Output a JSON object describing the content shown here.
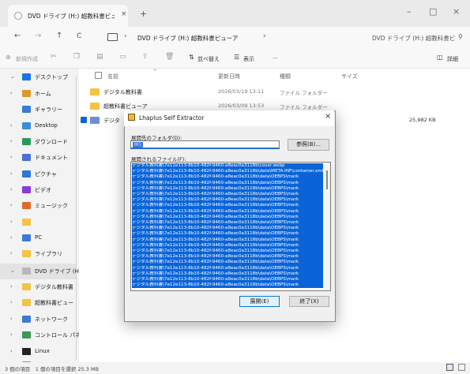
{
  "window": {
    "tab_title": "DVD ドライブ (H:) 超教科書ビューア",
    "tab_close": "×",
    "new_tab": "+",
    "controls": {
      "minimize": "–",
      "maximize": "□",
      "close": "×"
    }
  },
  "nav": {
    "back": "←",
    "forward": "→",
    "up": "↑",
    "refresh": "C",
    "address": "DVD ドライブ (H:) 超教科書ビューア",
    "address_sep": "›",
    "search_placeholder": "DVD ドライブ (H:) 超教科書ビ",
    "search_glyph": "⚲"
  },
  "command_bar": {
    "new": "新規作成",
    "sort": "並べ替え",
    "view": "表示",
    "more": "···",
    "details": "詳細"
  },
  "sidebar": {
    "items": [
      {
        "label": "デスクトップ",
        "chev": "⌄",
        "color": "#1a73e8"
      },
      {
        "label": "ホーム",
        "chev": "›",
        "color": "#d89a2a"
      },
      {
        "label": "ギャラリー",
        "chev": "",
        "color": "#3a7bd5"
      },
      {
        "label": "Desktop",
        "chev": "›",
        "color": "#3a8fd8"
      },
      {
        "label": "ダウンロード",
        "chev": "›",
        "color": "#2a9a5a"
      },
      {
        "label": "ドキュメント",
        "chev": "›",
        "color": "#4a6fd8"
      },
      {
        "label": "ピクチャ",
        "chev": "›",
        "color": "#2a7ad8"
      },
      {
        "label": "ビデオ",
        "chev": "›",
        "color": "#8a3ad8"
      },
      {
        "label": "ミュージック",
        "chev": "›",
        "color": "#e06a2a"
      },
      {
        "label": "",
        "chev": "›",
        "color": "#f3c343"
      },
      {
        "label": "PC",
        "chev": "›",
        "color": "#3a7bd5"
      },
      {
        "label": "ライブラリ",
        "chev": "›",
        "color": "#f3c343"
      },
      {
        "label": "DVD ドライブ (H",
        "chev": "⌄",
        "color": "#b8b8b8"
      },
      {
        "label": "デジタル教科書",
        "chev": "›",
        "color": "#f3c343"
      },
      {
        "label": "超教科書ビュー",
        "chev": "›",
        "color": "#f3c343"
      },
      {
        "label": "ネットワーク",
        "chev": "›",
        "color": "#3a7bd5"
      },
      {
        "label": "コントロール パネ",
        "chev": "›",
        "color": "#3a9a5a"
      },
      {
        "label": "Linux",
        "chev": "›",
        "color": "#222222"
      },
      {
        "label": "ごみ箱",
        "chev": "",
        "color": "#7a9ab8"
      }
    ]
  },
  "file_list": {
    "headers": {
      "name": "名前",
      "date": "更新日時",
      "type": "種類",
      "size": "サイズ"
    },
    "rows": [
      {
        "name": "デジタル教科書",
        "date": "2026/03/19 13:11",
        "type": "ファイル フォルダー",
        "size": ""
      },
      {
        "name": "超教科書ビューア",
        "date": "2026/03/09 13:53",
        "type": "ファイル フォルダー",
        "size": ""
      },
      {
        "name": "デジタ",
        "date": "",
        "type": "",
        "size": "25,982 KB"
      }
    ]
  },
  "status": {
    "text": "3 個の項目　1 個の項目を選択 25.3 MB"
  },
  "dialog": {
    "title": "Lhaplus Self Extractor",
    "close": "×",
    "dest_label": "展開先のフォルダ(D):",
    "dest_value": "H:\\",
    "browse_label": "参照(B)...",
    "files_label": "展開されるファイル(F):",
    "files": [
      "デジタル教科書\\7e12e113-8b10-482f-9460-a8eac0a3118b\\cover.webp",
      "デジタル教科書\\7e12e113-8b10-482f-9460-a8eac0a3118b\\data\\META-INF\\container.xml",
      "デジタル教科書\\7e12e113-8b10-482f-9460-a8eac0a3118b\\data\\OEBPS\\mark",
      "デジタル教科書\\7e12e113-8b10-482f-9460-a8eac0a3118b\\data\\OEBPS\\mark",
      "デジタル教科書\\7e12e113-8b10-482f-9460-a8eac0a3118b\\data\\OEBPS\\mark",
      "デジタル教科書\\7e12e113-8b10-482f-9460-a8eac0a3118b\\data\\OEBPS\\mark",
      "デジタル教科書\\7e12e113-8b10-482f-9460-a8eac0a3118b\\data\\OEBPS\\mark",
      "デジタル教科書\\7e12e113-8b10-482f-9460-a8eac0a3118b\\data\\OEBPS\\mark",
      "デジタル教科書\\7e12e113-8b10-482f-9460-a8eac0a3118b\\data\\OEBPS\\mark",
      "デジタル教科書\\7e12e113-8b10-482f-9460-a8eac0a3118b\\data\\OEBPS\\mark",
      "デジタル教科書\\7e12e113-8b10-482f-9460-a8eac0a3118b\\data\\OEBPS\\mark",
      "デジタル教科書\\7e12e113-8b10-482f-9460-a8eac0a3118b\\data\\OEBPS\\mark",
      "デジタル教科書\\7e12e113-8b10-482f-9460-a8eac0a3118b\\data\\OEBPS\\mark",
      "デジタル教科書\\7e12e113-8b10-482f-9460-a8eac0a3118b\\data\\OEBPS\\mark",
      "デジタル教科書\\7e12e113-8b10-482f-9460-a8eac0a3118b\\data\\OEBPS\\mark",
      "デジタル教科書\\7e12e113-8b10-482f-9460-a8eac0a3118b\\data\\OEBPS\\mark",
      "デジタル教科書\\7e12e113-8b10-482f-9460-a8eac0a3118b\\data\\OEBPS\\mark",
      "デジタル教科書\\7e12e113-8b10-482f-9460-a8eac0a3118b\\data\\OEBPS\\mark",
      "デジタル教科書\\7e12e113-8b10-482f-9460-a8eac0a3118b\\data\\OEBPS\\mark",
      "デジタル教科書\\7e12e113-8b10-482f-9460-a8eac0a3118b\\data\\OEBPS\\mark",
      "デジタル教科書\\7e12e113-8b10-482f-9460-a8eac0a3118b\\data\\OEBPS\\mark",
      "デジタル教科書\\7e12e113-8b10-482f-9460-a8eac0a3118b\\data\\OEBPS\\mark"
    ],
    "extract_label": "展開(E)",
    "quit_label": "終了(X)"
  },
  "colors": {
    "accent": "#0078d7",
    "selection": "#0a64d8",
    "folder": "#f3c343"
  }
}
